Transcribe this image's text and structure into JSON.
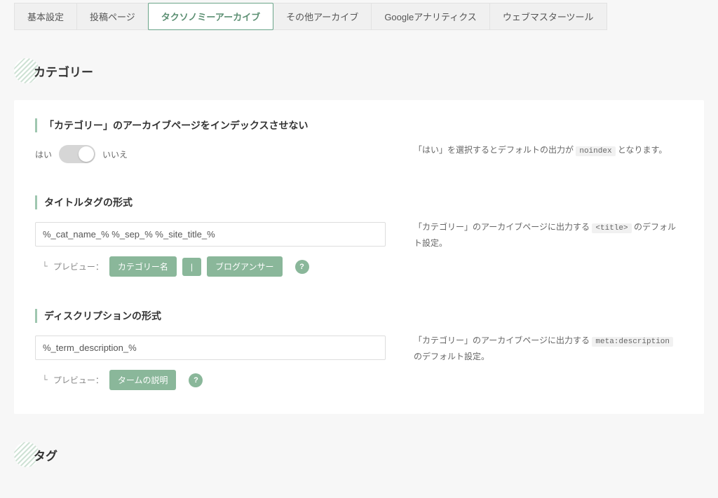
{
  "tabs": [
    {
      "label": "基本設定"
    },
    {
      "label": "投稿ページ"
    },
    {
      "label": "タクソノミーアーカイブ",
      "active": true
    },
    {
      "label": "その他アーカイブ"
    },
    {
      "label": "Googleアナリティクス"
    },
    {
      "label": "ウェブマスターツール"
    }
  ],
  "sections": {
    "category": {
      "title": "カテゴリー",
      "noindex": {
        "label": "「カテゴリー」のアーカイブページをインデックスさせない",
        "yes": "はい",
        "no": "いいえ",
        "help_prefix": "「はい」を選択するとデフォルトの出力が ",
        "help_code": "noindex",
        "help_suffix": " となります。"
      },
      "title_tag": {
        "label": "タイトルタグの形式",
        "value": "%_cat_name_% %_sep_% %_site_title_%",
        "preview_label": "プレビュー：",
        "chips": [
          "カテゴリー名",
          "|",
          "ブログアンサー"
        ],
        "help_q": "?",
        "help_prefix": "「カテゴリー」のアーカイブページに出力する ",
        "help_code": "<title>",
        "help_suffix": " のデフォルト設定。"
      },
      "description": {
        "label": "ディスクリプションの形式",
        "value": "%_term_description_%",
        "preview_label": "プレビュー：",
        "chips": [
          "タームの説明"
        ],
        "help_q": "?",
        "help_prefix": "「カテゴリー」のアーカイブページに出力する ",
        "help_code": "meta:description",
        "help_suffix": " のデフォルト設定。"
      }
    },
    "tag": {
      "title": "タグ"
    }
  }
}
